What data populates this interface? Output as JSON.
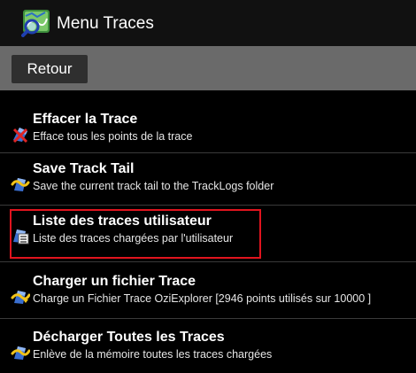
{
  "header": {
    "title": "Menu Traces",
    "logo_icon": "route-map-icon"
  },
  "toolbar": {
    "back_label": "Retour"
  },
  "menu": {
    "items": [
      {
        "title": "Effacer la Trace",
        "subtitle": "Efface tous les points de la trace",
        "icon": "erase-trace-icon"
      },
      {
        "title": "Save Track Tail",
        "subtitle": "Save the current track tail to the TrackLogs folder",
        "icon": "save-track-icon"
      },
      {
        "title": "Liste des traces utilisateur",
        "subtitle": "Liste des traces chargées par l'utilisateur",
        "icon": "trace-list-icon",
        "highlighted": true
      },
      {
        "title": "Charger un fichier Trace",
        "subtitle": "Charge un Fichier Trace OziExplorer [2946 points utilisés sur 10000 ]",
        "icon": "load-trace-icon"
      },
      {
        "title": "Décharger Toutes les Traces",
        "subtitle": "Enlève de la mémoire toutes les traces chargées",
        "icon": "unload-traces-icon"
      }
    ]
  },
  "colors": {
    "background": "#000000",
    "toolbar": "#6a6a6a",
    "button": "#2f2f2f",
    "highlight": "#e0141e"
  }
}
